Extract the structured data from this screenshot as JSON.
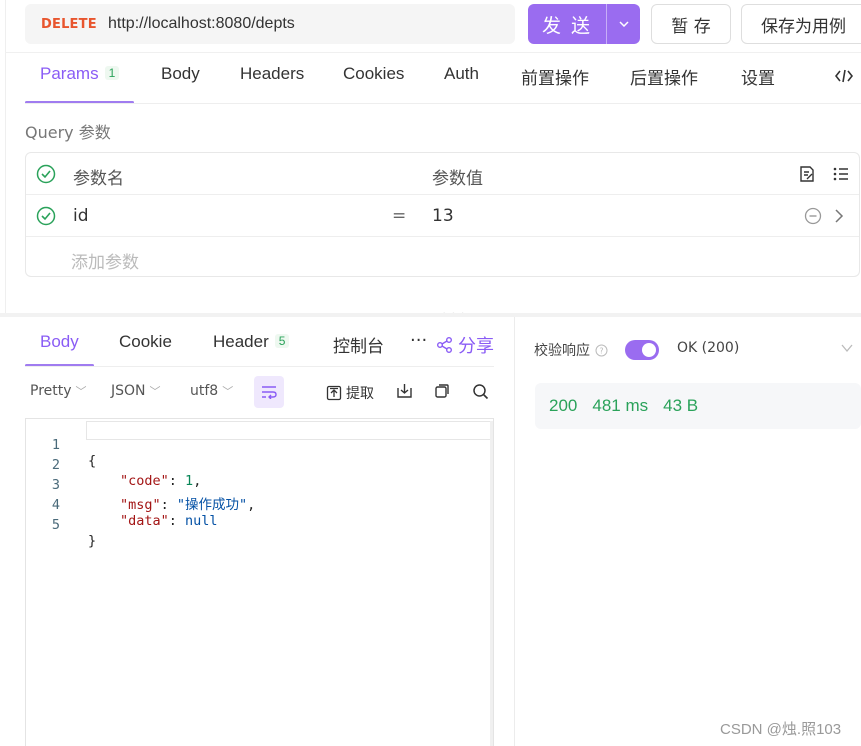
{
  "request": {
    "method": "DELETE",
    "url": "http://localhost:8080/depts",
    "send_label": "发 送",
    "save_label": "暂 存",
    "save_as_example_label": "保存为用例"
  },
  "request_tabs": [
    {
      "label": "Params",
      "badge": "1"
    },
    {
      "label": "Body"
    },
    {
      "label": "Headers"
    },
    {
      "label": "Cookies"
    },
    {
      "label": "Auth"
    },
    {
      "label": "前置操作"
    },
    {
      "label": "后置操作"
    },
    {
      "label": "设置"
    }
  ],
  "query": {
    "title": "Query 参数",
    "header": {
      "name": "参数名",
      "value": "参数值"
    },
    "rows": [
      {
        "name": "id",
        "operator": "=",
        "value": "13"
      }
    ],
    "add_placeholder": "添加参数"
  },
  "response_tabs": [
    {
      "label": "Body"
    },
    {
      "label": "Cookie"
    },
    {
      "label": "Header",
      "badge": "5"
    },
    {
      "label": "控制台"
    }
  ],
  "more_label": "···",
  "share_label": "分享",
  "toolbar": {
    "format": "Pretty",
    "type": "JSON",
    "encoding": "utf8",
    "extract_label": "提取"
  },
  "code_lines": [
    {
      "num": "1"
    },
    {
      "num": "2"
    },
    {
      "num": "3"
    },
    {
      "num": "4"
    },
    {
      "num": "5"
    }
  ],
  "code": {
    "open": "{",
    "code_key": "\"code\"",
    "code_val": "1",
    "msg_key": "\"msg\"",
    "msg_val": "\"操作成功\"",
    "data_key": "\"data\"",
    "data_val": "null",
    "close": "}"
  },
  "verify": {
    "label": "校验响应",
    "enabled": true,
    "status_option": "OK (200)"
  },
  "stats": {
    "status": "200",
    "time": "481 ms",
    "size": "43 B"
  },
  "watermark": "CSDN @烛.照103",
  "colors": {
    "accent": "#9a6cf0",
    "method": "#e8552e",
    "success": "#2aa25a"
  }
}
